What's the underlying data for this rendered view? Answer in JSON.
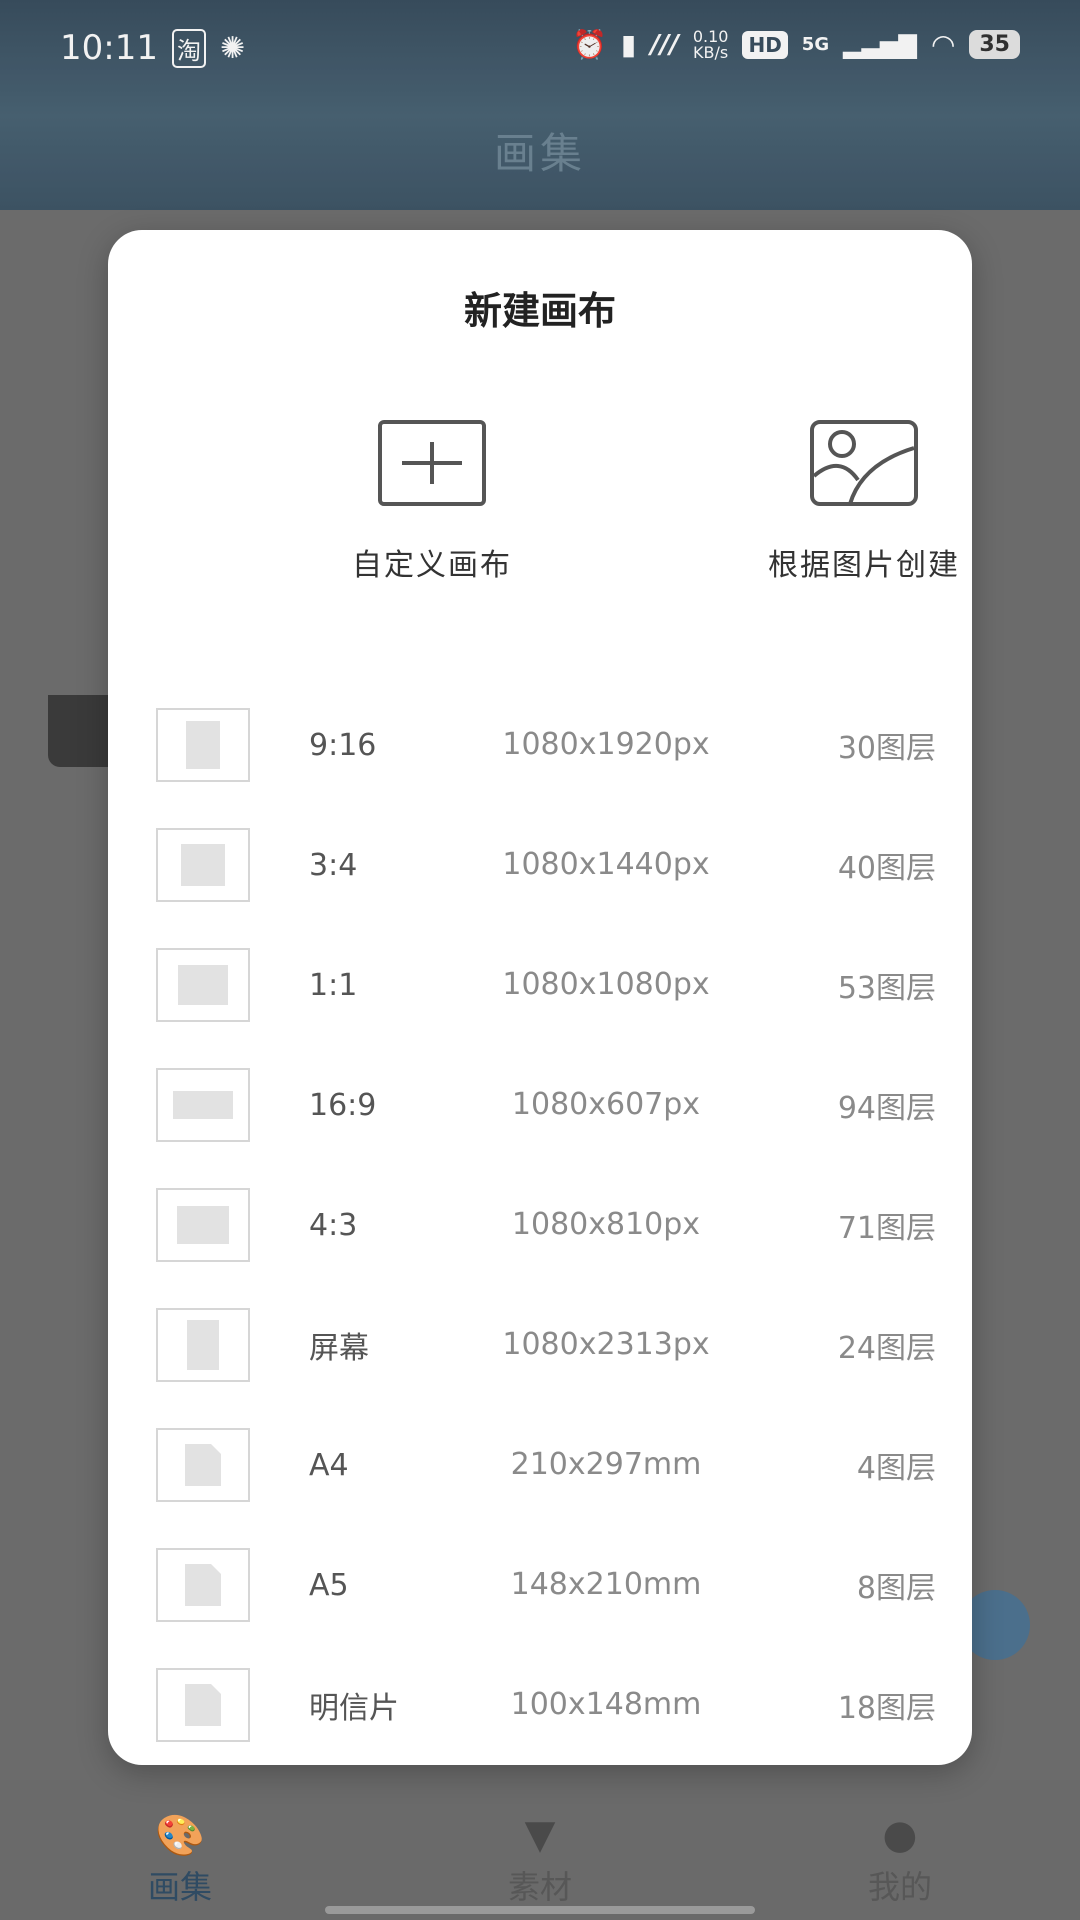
{
  "status_bar": {
    "time": "10:11",
    "net_speed": "0.10",
    "net_unit": "KB/s",
    "hd": "HD",
    "network": "5G",
    "battery": "35"
  },
  "app": {
    "title": "画集"
  },
  "modal": {
    "title": "新建画布",
    "options": [
      {
        "label": "自定义画布",
        "icon": "plus-square-icon"
      },
      {
        "label": "根据图片创建",
        "icon": "image-icon"
      }
    ],
    "presets": [
      {
        "ratio": "9:16",
        "size": "1080x1920px",
        "layers": "30图层"
      },
      {
        "ratio": "3:4",
        "size": "1080x1440px",
        "layers": "40图层"
      },
      {
        "ratio": "1:1",
        "size": "1080x1080px",
        "layers": "53图层"
      },
      {
        "ratio": "16:9",
        "size": "1080x607px",
        "layers": "94图层"
      },
      {
        "ratio": "4:3",
        "size": "1080x810px",
        "layers": "71图层"
      },
      {
        "ratio": "屏幕",
        "size": "1080x2313px",
        "layers": "24图层"
      },
      {
        "ratio": "A4",
        "size": "210x297mm",
        "layers": "4图层"
      },
      {
        "ratio": "A5",
        "size": "148x210mm",
        "layers": "8图层"
      },
      {
        "ratio": "明信片",
        "size": "100x148mm",
        "layers": "18图层"
      }
    ]
  },
  "bottom_nav": {
    "items": [
      {
        "label": "画集",
        "icon": "palette-icon",
        "active": true
      },
      {
        "label": "素材",
        "icon": "brush-icon",
        "active": false
      },
      {
        "label": "我的",
        "icon": "person-icon",
        "active": false
      }
    ]
  },
  "colors": {
    "accent": "#2f4b63",
    "header": "#3f5667",
    "overlay": "#6b6b6b"
  }
}
